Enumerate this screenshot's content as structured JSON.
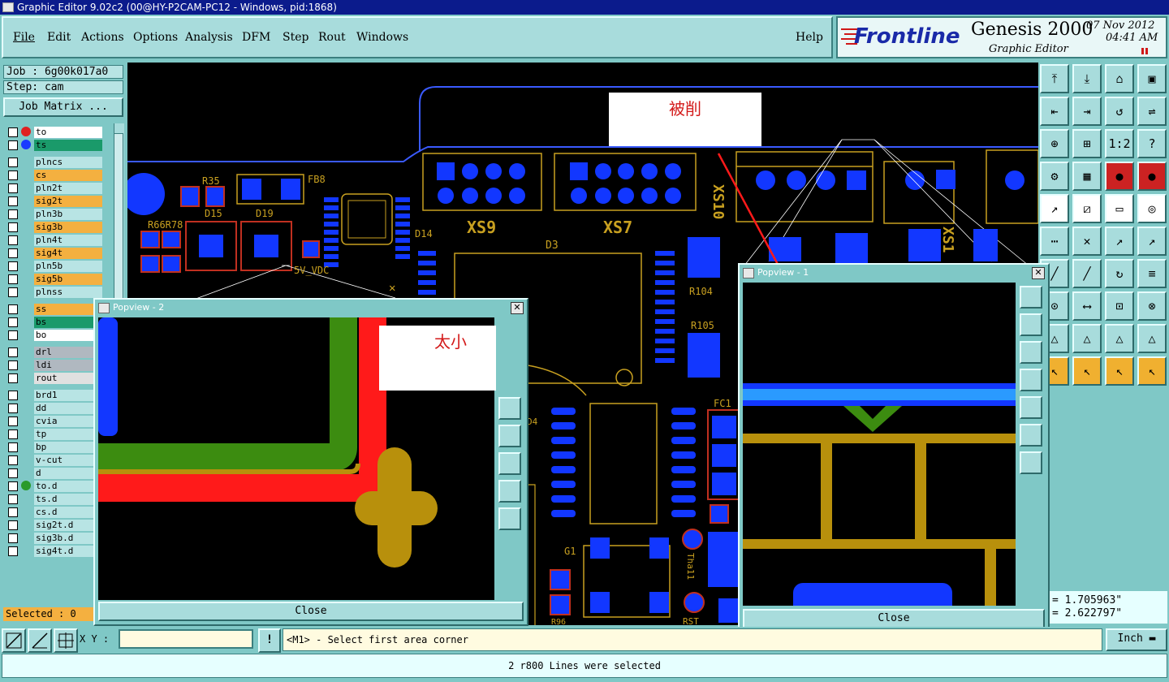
{
  "window": {
    "title": "Graphic Editor 9.02c2 (00@HY-P2CAM-PC12 - Windows, pid:1868)"
  },
  "menu": {
    "items": [
      "File",
      "Edit",
      "Actions",
      "Options",
      "Analysis",
      "DFM",
      "Step",
      "Rout",
      "Windows"
    ],
    "help": "Help"
  },
  "logo": {
    "brand": "Frontline",
    "product": "Genesis 2000",
    "subtitle": "Graphic Editor",
    "date": "07  Nov  2012",
    "time": "04:41  AM"
  },
  "job": {
    "job_label": "Job : 6g00k017a0",
    "step_label": "Step: cam",
    "matrix_button": "Job Matrix ..."
  },
  "layers": [
    {
      "name": "to",
      "bg": "#ffffff",
      "dot": "#e02020"
    },
    {
      "name": "ts",
      "bg": "#1a9a6a",
      "dot": "#1a3aff"
    },
    {
      "name": "plncs",
      "bg": "#b8e4e4"
    },
    {
      "name": "cs",
      "bg": "#f4b040"
    },
    {
      "name": "pln2t",
      "bg": "#b8e4e4"
    },
    {
      "name": "sig2t",
      "bg": "#f4b040"
    },
    {
      "name": "pln3b",
      "bg": "#b8e4e4"
    },
    {
      "name": "sig3b",
      "bg": "#f4b040"
    },
    {
      "name": "pln4t",
      "bg": "#b8e4e4"
    },
    {
      "name": "sig4t",
      "bg": "#f4b040"
    },
    {
      "name": "pln5b",
      "bg": "#b8e4e4"
    },
    {
      "name": "sig5b",
      "bg": "#f4b040"
    },
    {
      "name": "plnss",
      "bg": "#b8e4e4"
    },
    {
      "name": "ss",
      "bg": "#f4b040"
    },
    {
      "name": "bs",
      "bg": "#1a9a6a"
    },
    {
      "name": "bo",
      "bg": "#ffffff"
    },
    {
      "name": "drl",
      "bg": "#b0b8c0"
    },
    {
      "name": "ldi",
      "bg": "#b0b8c0"
    },
    {
      "name": "rout",
      "bg": "#e0e0e0"
    },
    {
      "name": "brd1",
      "bg": "#b8e4e4"
    },
    {
      "name": "dd",
      "bg": "#b8e4e4"
    },
    {
      "name": "cvia",
      "bg": "#b8e4e4"
    },
    {
      "name": "tp",
      "bg": "#b8e4e4"
    },
    {
      "name": "bp",
      "bg": "#b8e4e4"
    },
    {
      "name": "v-cut",
      "bg": "#b8e4e4"
    },
    {
      "name": "d",
      "bg": "#b8e4e4"
    },
    {
      "name": "to.d",
      "bg": "#b8e4e4",
      "dot": "#2a9a2a"
    },
    {
      "name": "ts.d",
      "bg": "#b8e4e4"
    },
    {
      "name": "cs.d",
      "bg": "#b8e4e4"
    },
    {
      "name": "sig2t.d",
      "bg": "#b8e4e4"
    },
    {
      "name": "sig3b.d",
      "bg": "#b8e4e4"
    },
    {
      "name": "sig4t.d",
      "bg": "#b8e4e4"
    }
  ],
  "selected": "Selected : 0",
  "board_labels": {
    "r35": "R35",
    "fb8": "FB8",
    "r66r78": "R66R78",
    "d15": "D15",
    "d19": "D19",
    "d14": "D14",
    "xs9": "XS9",
    "xs7": "XS7",
    "xs10": "XS10",
    "xs1": "XS1",
    "d3": "D3",
    "r104": "R104",
    "r105": "R105",
    "vdc": "5V_VDC",
    "fc1": "FC1",
    "g1": "G1",
    "d4": "D4",
    "r96": "R96",
    "rst": "RST",
    "tha": "Tha11"
  },
  "annotations": {
    "cut": "被削",
    "small": "太小"
  },
  "popview1": {
    "title": "Popview - 1",
    "close": "Close"
  },
  "popview2": {
    "title": "Popview - 2",
    "close": "Close"
  },
  "coords": {
    "x": "= 1.705963\"",
    "y": "= 2.622797\""
  },
  "status": {
    "xy_label": "X Y :",
    "prompt": "<M1> - Select first area corner",
    "units": "Inch"
  },
  "message": "2 r800 Lines were selected",
  "colors": {
    "teal": "#7fc8c6",
    "pad_blue": "#1237ff",
    "silk_yellow": "#c8a020",
    "trace_red": "#ff1a1a",
    "trace_green": "#3c8c10"
  }
}
